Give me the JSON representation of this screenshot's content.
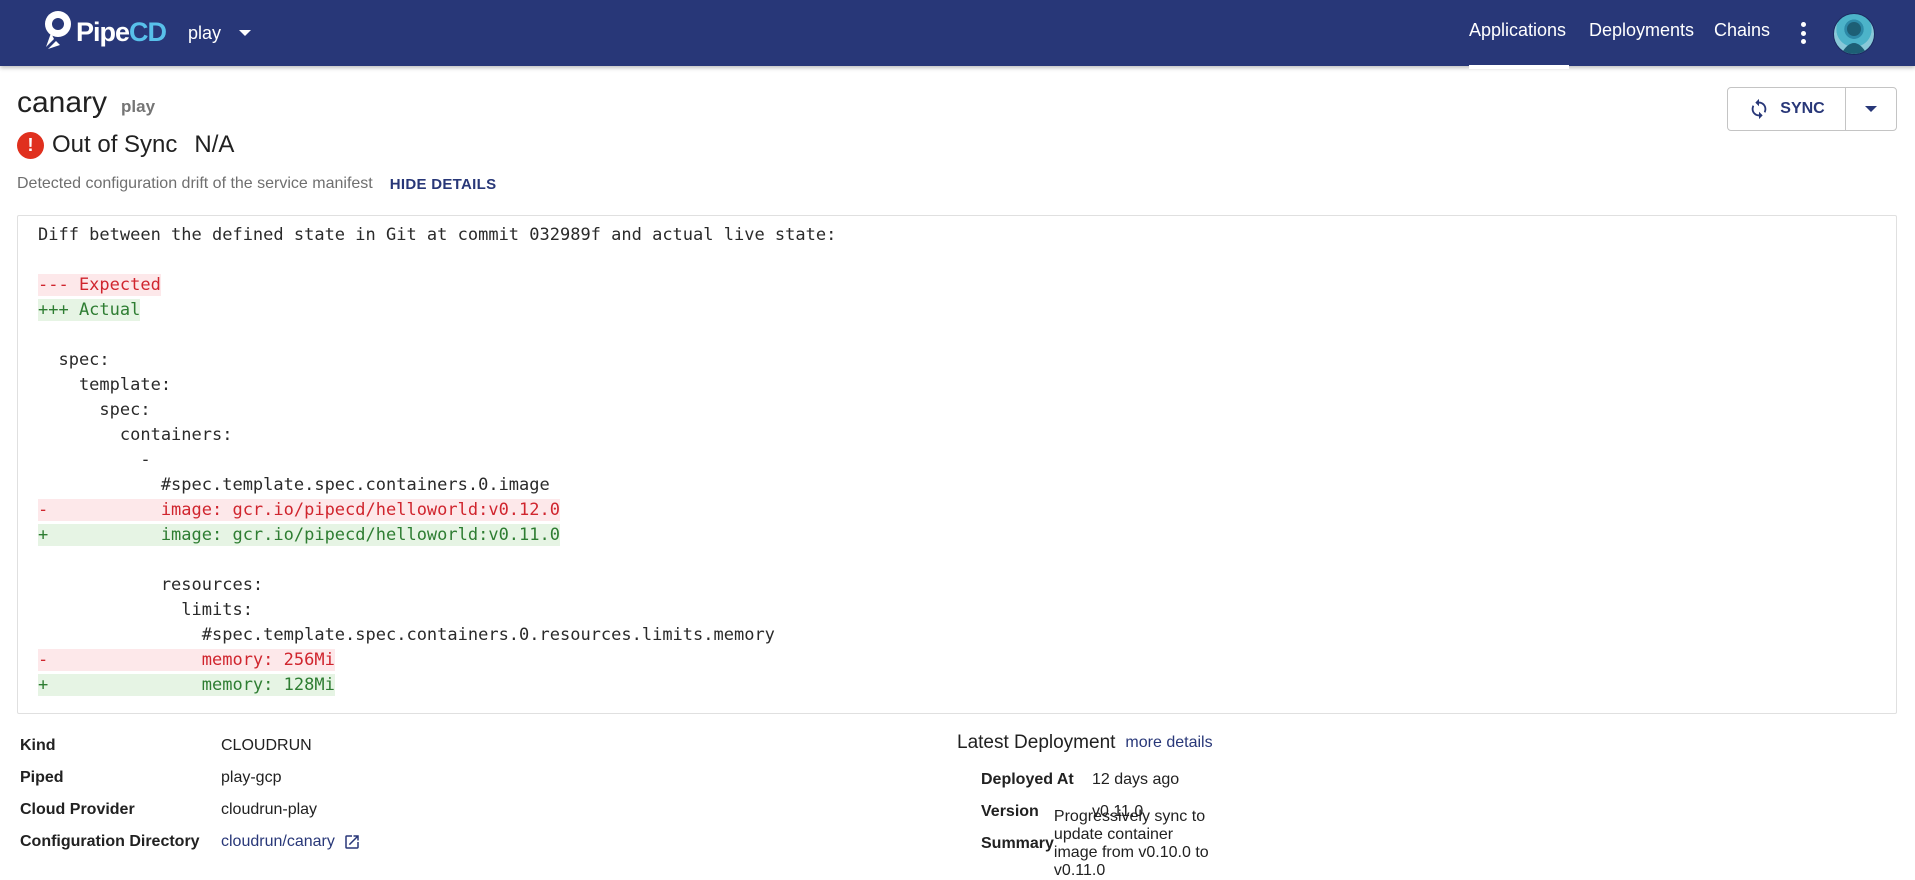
{
  "header": {
    "logo": {
      "text_main": "Pipe",
      "text_accent": "CD"
    },
    "project": "play",
    "nav": [
      "Applications",
      "Deployments",
      "Chains"
    ],
    "active_nav": "Applications",
    "colors": {
      "bar": "#283778",
      "accent": "#58c0ea"
    }
  },
  "app": {
    "name": "canary",
    "env": "play",
    "sync_status": "Out of Sync",
    "sync_detail": "N/A",
    "drift_reason": "Detected configuration drift of the service manifest",
    "hide_details_label": "HIDE DETAILS",
    "sync_button_label": "SYNC"
  },
  "diff": {
    "lines": [
      {
        "type": "plain",
        "text": "Diff between the defined state in Git at commit 032989f and actual live state:"
      },
      {
        "type": "plain",
        "text": ""
      },
      {
        "type": "del",
        "text": "--- Expected"
      },
      {
        "type": "add",
        "text": "+++ Actual"
      },
      {
        "type": "plain",
        "text": ""
      },
      {
        "type": "plain",
        "text": "  spec:"
      },
      {
        "type": "plain",
        "text": "    template:"
      },
      {
        "type": "plain",
        "text": "      spec:"
      },
      {
        "type": "plain",
        "text": "        containers:"
      },
      {
        "type": "plain",
        "text": "          -"
      },
      {
        "type": "plain",
        "text": "            #spec.template.spec.containers.0.image"
      },
      {
        "type": "del",
        "text": "-           image: gcr.io/pipecd/helloworld:v0.12.0"
      },
      {
        "type": "add",
        "text": "+           image: gcr.io/pipecd/helloworld:v0.11.0"
      },
      {
        "type": "plain",
        "text": ""
      },
      {
        "type": "plain",
        "text": "            resources:"
      },
      {
        "type": "plain",
        "text": "              limits:"
      },
      {
        "type": "plain",
        "text": "                #spec.template.spec.containers.0.resources.limits.memory"
      },
      {
        "type": "del",
        "text": "-               memory: 256Mi"
      },
      {
        "type": "add",
        "text": "+               memory: 128Mi"
      }
    ],
    "colors": {
      "del_bg": "#fde8ea",
      "del_fg": "#d0252e",
      "add_bg": "#e6f4e4",
      "add_fg": "#2e7d32"
    }
  },
  "details": {
    "kind_label": "Kind",
    "kind": "CLOUDRUN",
    "piped_label": "Piped",
    "piped": "play-gcp",
    "cloud_provider_label": "Cloud Provider",
    "cloud_provider": "cloudrun-play",
    "config_dir_label": "Configuration Directory",
    "config_dir": "cloudrun/canary"
  },
  "latest_deployment": {
    "title": "Latest Deployment",
    "more_details": "more details",
    "deployed_at_label": "Deployed At",
    "deployed_at": "12 days ago",
    "version_label": "Version",
    "version": "v0.11.0",
    "summary_label": "Summary",
    "summary": "Progressively sync to update container image from v0.10.0 to v0.11.0"
  }
}
